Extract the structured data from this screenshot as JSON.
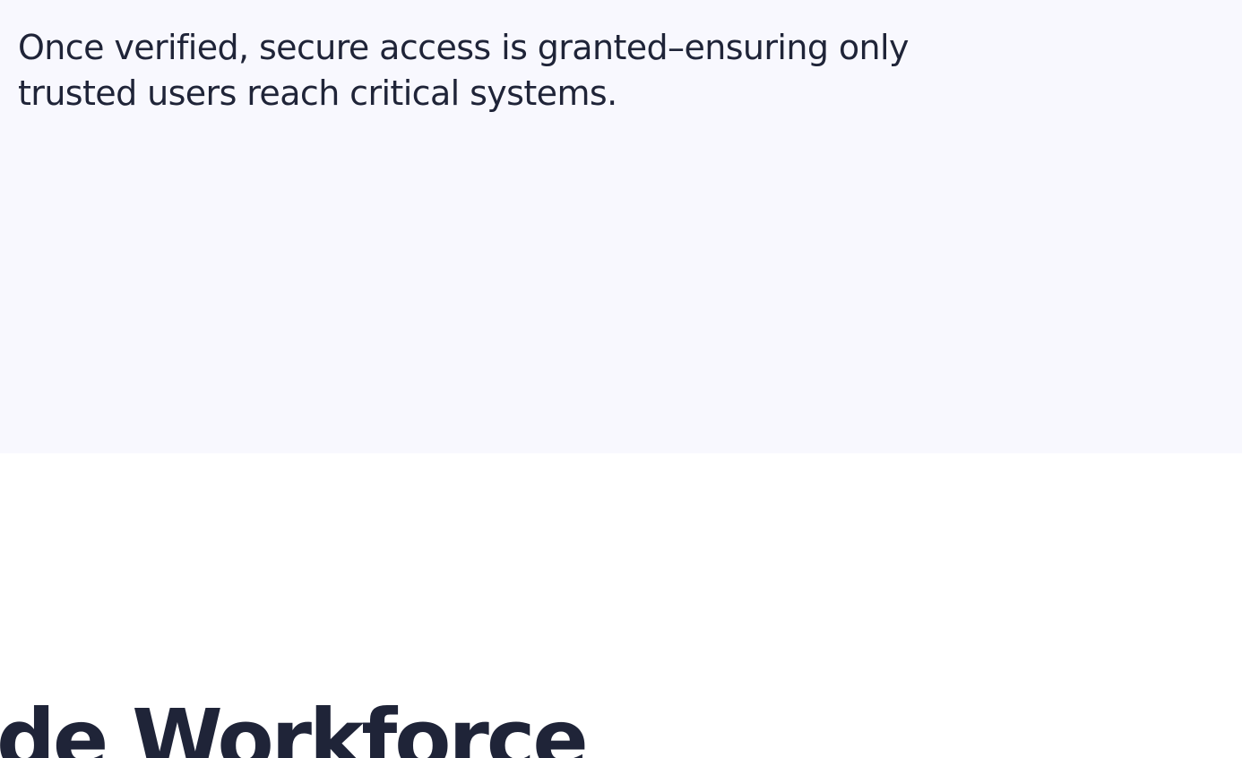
{
  "feature_card": {
    "description": "Once verified, secure access is granted–ensuring only trusted users reach critical systems."
  },
  "next_section": {
    "heading_partial": "de Workforce"
  },
  "colors": {
    "card_background": "#f8f8fe",
    "page_background": "#ffffff",
    "text": "#1f2438"
  }
}
